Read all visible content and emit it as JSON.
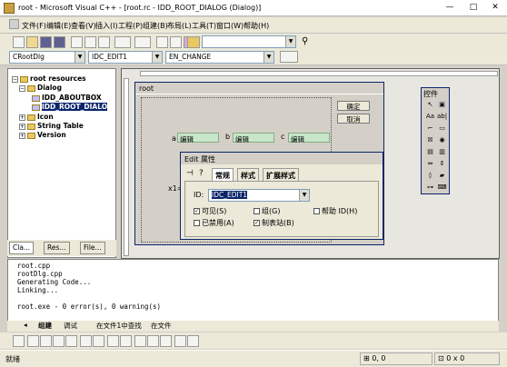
{
  "window": {
    "title": "root - Microsoft Visual C++ - [root.rc - IDD_ROOT_DIALOG (Dialog)]"
  },
  "menu": [
    "文件(F)",
    "编辑(E)",
    "查看(V)",
    "插入(I)",
    "工程(P)",
    "组建(B)",
    "布局(L)",
    "工具(T)",
    "窗口(W)",
    "帮助(H)"
  ],
  "toolbar": {
    "find_combo": ""
  },
  "wizardbar": {
    "class_combo": "CRootDlg",
    "id_combo": "IDC_EDIT1",
    "message_combo": "EN_CHANGE"
  },
  "workspace": {
    "tree": {
      "root": "root resources",
      "dialog_folder": "Dialog",
      "about": "IDD_ABOUTBOX",
      "rootdlg": "IDD_ROOT_DIALO",
      "icon": "Icon",
      "strtable": "String Table",
      "version": "Version"
    },
    "tabs": [
      "Cla...",
      "Res...",
      "File..."
    ]
  },
  "dialog": {
    "title": "root",
    "ok_label": "确定",
    "cancel_label": "取消",
    "labels": {
      "a": "a",
      "b": "b",
      "c": "c",
      "x1": "x1="
    },
    "edit_text": "编辑"
  },
  "properties": {
    "title": "Edit 属性",
    "tabs": [
      "常规",
      "样式",
      "扩展样式"
    ],
    "id_label": "ID:",
    "id_value": "IDC_EDIT1",
    "checks": {
      "visible": "可见(S)",
      "group": "组(G)",
      "help_id": "帮助 ID(H)",
      "disabled": "已禁用(A)",
      "tabstop": "制表站(B)"
    }
  },
  "controls_palette": {
    "title": "控件"
  },
  "output": {
    "lines": [
      "root.cpp",
      "rootDlg.cpp",
      "Generating Code...",
      "Linking...",
      "",
      "root.exe - 0 error(s), 0 warning(s)"
    ],
    "tabs": [
      "组建",
      "调试",
      "在文件1中查找",
      "在文件"
    ]
  },
  "status": {
    "ready": "就绪",
    "pos1": "0, 0",
    "pos2": "0 x 0"
  }
}
